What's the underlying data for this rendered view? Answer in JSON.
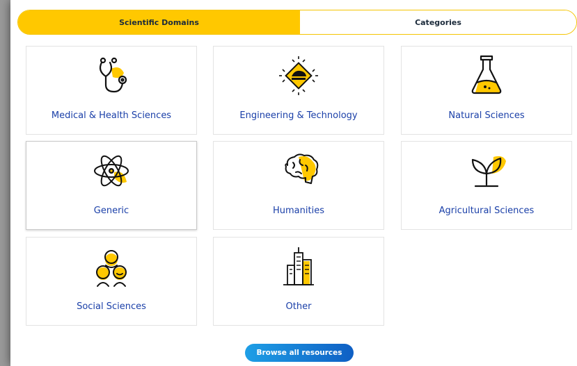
{
  "tabs": {
    "active_label": "Scientific Domains",
    "inactive_label": "Categories"
  },
  "domains": [
    {
      "label": "Medical & Health Sciences",
      "icon": "stethoscope-icon"
    },
    {
      "label": "Engineering & Technology",
      "icon": "chip-icon"
    },
    {
      "label": "Natural Sciences",
      "icon": "flask-icon"
    },
    {
      "label": "Generic",
      "icon": "atom-icon"
    },
    {
      "label": "Humanities",
      "icon": "brain-icon"
    },
    {
      "label": "Agricultural Sciences",
      "icon": "sprout-icon"
    },
    {
      "label": "Social Sciences",
      "icon": "people-icon"
    },
    {
      "label": "Other",
      "icon": "buildings-icon"
    }
  ],
  "browse_button": {
    "label": "Browse all resources"
  },
  "colors": {
    "accent_yellow": "#ffc800",
    "link_blue": "#1a3fa8",
    "button_gradient_start": "#1e9fe6",
    "button_gradient_end": "#0f5fc4"
  }
}
